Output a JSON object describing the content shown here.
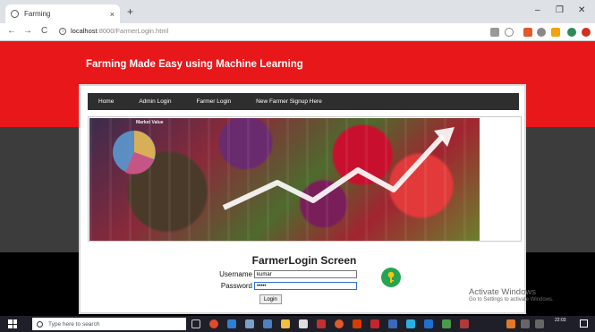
{
  "browser": {
    "tab_title": "Farming",
    "tab_close": "×",
    "new_tab": "+",
    "url_host": "localhost",
    "url_path": ":8000/FarmerLogin.html",
    "back": "←",
    "forward": "→",
    "reload": "C",
    "minimize": "–",
    "maximize": "❐",
    "close": "✕"
  },
  "site": {
    "title": "Farming Made Easy using Machine Learning",
    "menu": [
      "Home",
      "Admin Login",
      "Farmer Login",
      "New Farmer Signup Here"
    ],
    "banner_label": "Market Value"
  },
  "login": {
    "title": "FarmerLogin Screen",
    "username_label": "Username",
    "username_value": "kumar",
    "password_label": "Password",
    "password_value": "•••••",
    "button_label": "Login"
  },
  "watermark": {
    "line1": "Activate Windows",
    "line2": "Go to Settings to activate Windows."
  },
  "taskbar": {
    "search_placeholder": "Type here to search",
    "time": "22:03"
  },
  "colors": {
    "header_red": "#e8171a",
    "menu_dark": "#2e2e2e",
    "key_green": "#25a552"
  }
}
